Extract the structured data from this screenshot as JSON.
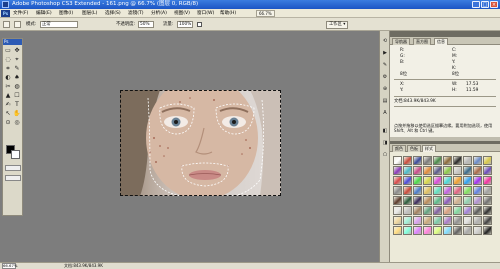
{
  "titlebar": {
    "title": "Adobe Photoshop CS3 Extended - 161.png @ 66.7% (图层 0, RGB/8)",
    "buttons": [
      "_",
      "□",
      "×"
    ]
  },
  "menubar": {
    "logo": "Ps",
    "items": [
      "文件(F)",
      "编辑(E)",
      "图像(I)",
      "图层(L)",
      "选择(S)",
      "滤镜(T)",
      "分析(A)",
      "视图(V)",
      "窗口(W)",
      "帮助(H)"
    ],
    "zoom_field": "66.7%"
  },
  "optbar": {
    "mode_label": "模式:",
    "mode_value": "正常",
    "opacity_label": "不透明度:",
    "opacity_value": "50%",
    "flow_label": "流量:",
    "flow_value": "100%",
    "workspace_label": "工作区 ▾"
  },
  "toolbox": {
    "header": "Ps",
    "tools": [
      "▭",
      "✥",
      "◌",
      "⌖",
      "⌗",
      "✎",
      "◐",
      "♠",
      "✂",
      "◍",
      "▲",
      "☐",
      "✍",
      "T",
      "↖",
      "✋",
      "⊙",
      "◎"
    ],
    "fg_color": "#000000",
    "bg_color": "#ffffff"
  },
  "status": {
    "zoom": "66.67%",
    "info": "文档:843.9K/843.9K"
  },
  "panels": {
    "top_tabs": [
      "导航器",
      "直方图",
      "信息"
    ],
    "info": {
      "r": "R:",
      "g": "G:",
      "b": "B:",
      "c": "C:",
      "m": "M:",
      "y": "Y:",
      "k": "K:",
      "bits1": "8位",
      "bits2": "8位",
      "x": "X:",
      "y_coord": "Y:",
      "x_val": "17.53",
      "y_val": "11.59",
      "w": "W:",
      "h": "H:"
    },
    "doc_size": "文档:843.9K/843.9K",
    "hint": "点按并拖移以使用选区描摹边缘。要用附加选项，使用 Shift、Alt 和 Ctrl 键。",
    "style_tabs": [
      "颜色",
      "色板",
      "样式"
    ],
    "style_colors": [
      "#ffffff",
      "#c84a3a",
      "#3b4a9a",
      "#7a7a7a",
      "#4a8a4a",
      "#8a6a3a",
      "#2a2a2a",
      "#b9b9b9",
      "#6a8ac8",
      "#d8c84a",
      "#8a3ab9",
      "#4ab9c8",
      "#c84a8a",
      "#e08a3a",
      "#5a5a8a",
      "#8ac84a",
      "#c8c8c8",
      "#3a6a8a",
      "#a86a4a",
      "#6a4ab9",
      "#d84a4a",
      "#4a4ad8",
      "#4ad84a",
      "#d8d84a",
      "#d84ad8",
      "#4ad8d8",
      "#f0a030",
      "#30a0f0",
      "#a030f0",
      "#f030a0",
      "#8a8a8a",
      "#c84a3a",
      "#4a7ac8",
      "#e0c060",
      "#60e0c0",
      "#c060e0",
      "#e06080",
      "#80e060",
      "#6080e0",
      "#a0a0a0",
      "#5a3a2a",
      "#2a5a3a",
      "#3a2a5a",
      "#b98a5a",
      "#5ab98a",
      "#8a5ab9",
      "#d0b090",
      "#90d0b0",
      "#b090d0",
      "#707070",
      "#e8e8e8",
      "#c0c0c0",
      "#a08060",
      "#60a080",
      "#8060a0",
      "#d8a080",
      "#80d8a0",
      "#a080d8",
      "#5a5a5a",
      "#303030",
      "#f0d8a0",
      "#a0f0d8",
      "#d8a0f0",
      "#c8a87a",
      "#7ac8a8",
      "#a87ac8",
      "#909090",
      "#e0e0e0",
      "#b0b0b0",
      "#404040",
      "#ffdc80",
      "#80ffdc",
      "#dc80ff",
      "#ff80dc",
      "#dcff80",
      "#80dcff",
      "#606060",
      "#a8a8a8",
      "#d0d0d0",
      "#202020"
    ]
  }
}
